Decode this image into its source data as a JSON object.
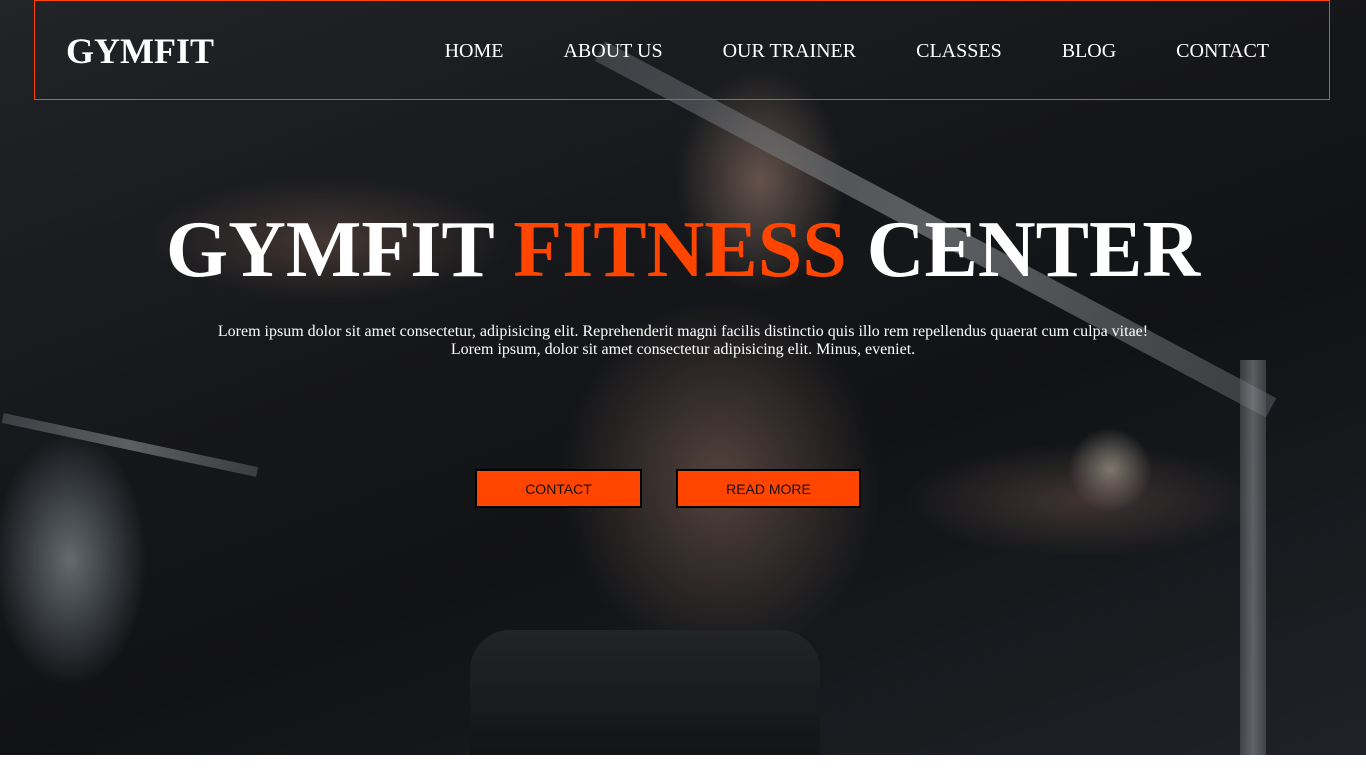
{
  "brand": {
    "logo": "GYMFIT",
    "accent_color": "#ff4500"
  },
  "nav": {
    "items": [
      {
        "label": "HOME"
      },
      {
        "label": "ABOUT US"
      },
      {
        "label": "OUR TRAINER"
      },
      {
        "label": "CLASSES"
      },
      {
        "label": "BLOG"
      },
      {
        "label": "CONTACT"
      }
    ]
  },
  "hero": {
    "title_part1": "GYMFIT ",
    "title_accent": "FITNESS",
    "title_part2": " CENTER",
    "text_line1": "Lorem ipsum dolor sit amet consectetur, adipisicing elit. Reprehenderit magni facilis distinctio quis illo rem repellendus quaerat cum culpa vitae!",
    "text_line2": "Lorem ipsum, dolor sit amet consectetur adipisicing elit. Minus, eveniet.",
    "contact_button": "CONTACT",
    "read_more_button": "READ MORE"
  }
}
